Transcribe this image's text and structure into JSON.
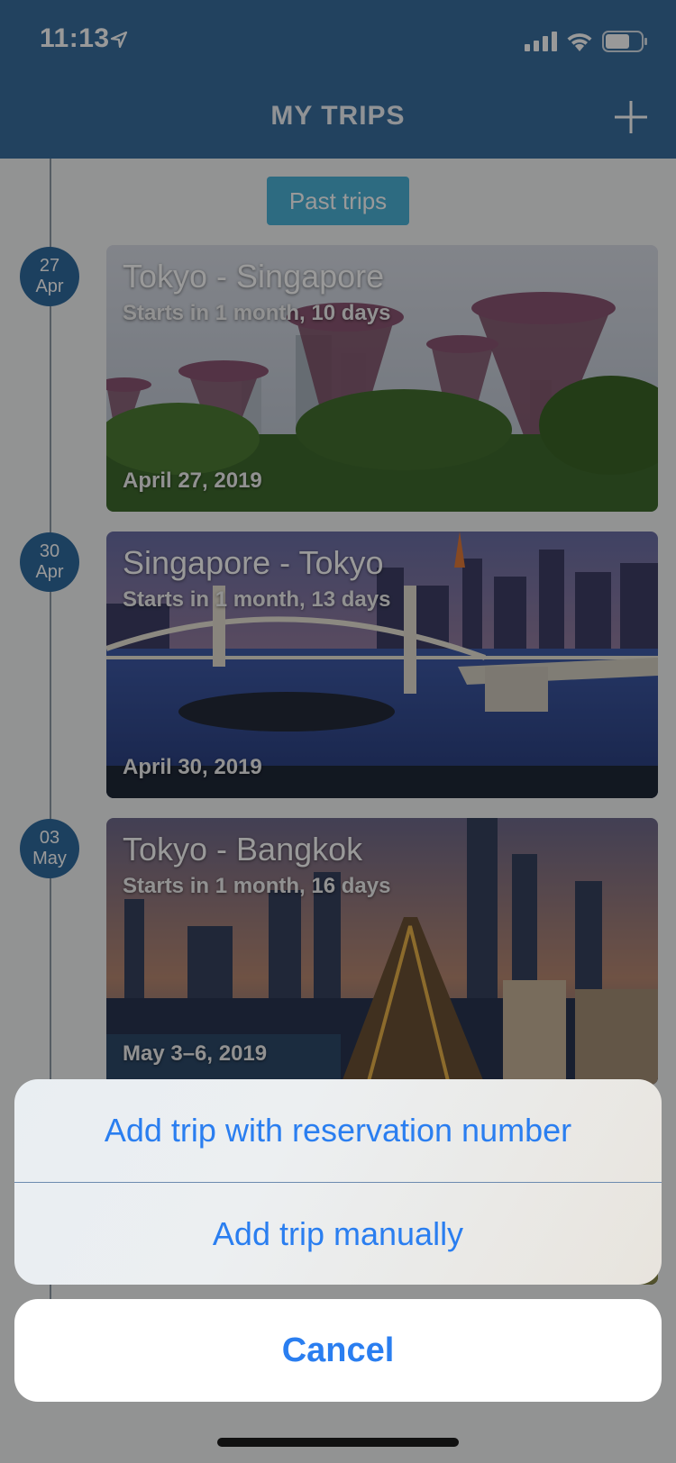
{
  "status_bar": {
    "time": "11:13"
  },
  "nav": {
    "title": "MY TRIPS"
  },
  "past_trips_label": "Past trips",
  "trips": [
    {
      "day": "27",
      "month": "Apr",
      "title": "Tokyo - Singapore",
      "subtitle": "Starts in 1 month, 10 days",
      "date": "April 27, 2019"
    },
    {
      "day": "30",
      "month": "Apr",
      "title": "Singapore - Tokyo",
      "subtitle": "Starts in 1 month, 13 days",
      "date": "April 30, 2019"
    },
    {
      "day": "03",
      "month": "May",
      "title": "Tokyo - Bangkok",
      "subtitle": "Starts in 1 month, 16 days",
      "date": "May 3–6, 2019"
    }
  ],
  "action_sheet": {
    "options": [
      "Add trip with reservation number",
      "Add trip manually"
    ],
    "cancel": "Cancel"
  },
  "colors": {
    "header": "#3a6f9e",
    "accent_blue": "#2a7ef0",
    "past_trips_button": "#4bb3d8",
    "date_badge": "#2f6b9f"
  }
}
